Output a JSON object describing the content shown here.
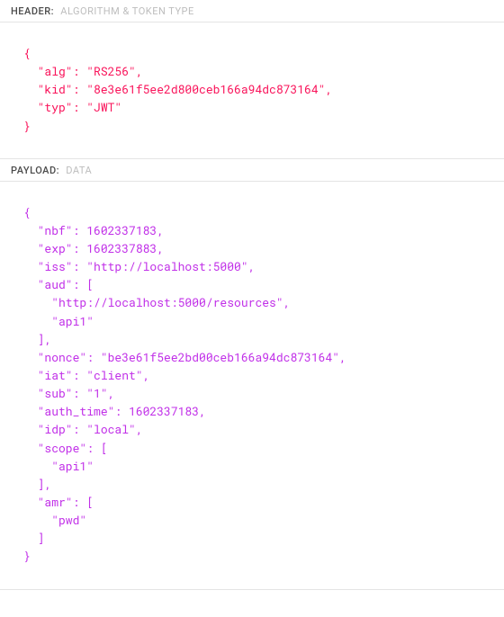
{
  "sections": {
    "header": {
      "title": "HEADER:",
      "subtitle": "ALGORITHM & TOKEN TYPE"
    },
    "payload": {
      "title": "PAYLOAD:",
      "subtitle": "DATA"
    }
  },
  "jwt": {
    "header": {
      "alg": "RS256",
      "kid": "8e3e61f5ee2d800ceb166a94dc873164",
      "typ": "JWT"
    },
    "payload": {
      "nbf": 1602337183,
      "exp": 1602337883,
      "iss": "http://localhost:5000",
      "aud": [
        "http://localhost:5000/resources",
        "api1"
      ],
      "nonce": "be3e61f5ee2bd00ceb166a94dc873164",
      "iat": "client",
      "sub": "1",
      "auth_time": 1602337183,
      "idp": "local",
      "scope": [
        "api1"
      ],
      "amr": [
        "pwd"
      ]
    }
  }
}
